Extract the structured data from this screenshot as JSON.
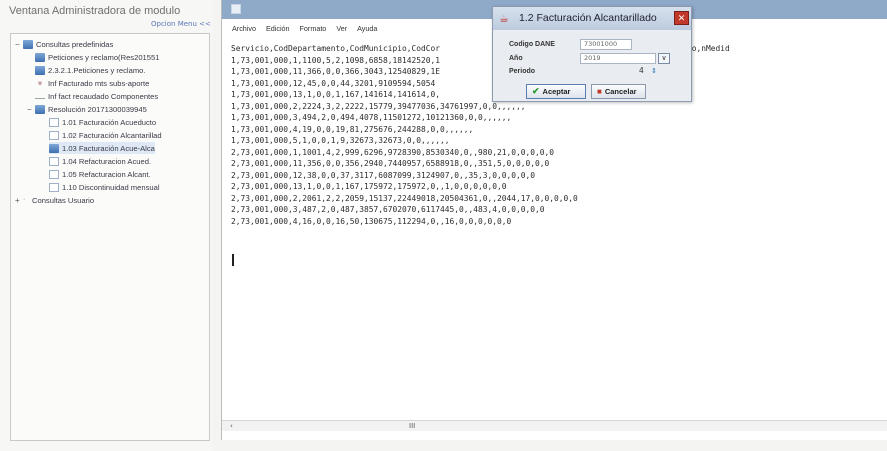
{
  "left_panel": {
    "title": "Ventana Administradora de modulo",
    "options_menu": "Opcion Menu <<",
    "tree": [
      {
        "label": "Consultas predefinidas",
        "expand": "−",
        "icon": "db-icon"
      },
      {
        "label": "Peticiones y reclamo(Res201551",
        "expand": "",
        "icon": "db-icon"
      },
      {
        "label": "2.3.2.1.Peticiones y reclamo.",
        "expand": "",
        "icon": "db-icon"
      },
      {
        "label": "Inf Facturado mts subs-aporte",
        "expand": "",
        "icon": "heart-icon"
      },
      {
        "label": "Inf fact recaudado Componentes",
        "expand": "",
        "icon": "dash-icon"
      },
      {
        "label": "Resolución 20171300039945",
        "expand": "−",
        "icon": "db-icon"
      },
      {
        "label": "1.01 Facturación Acueducto",
        "expand": "",
        "icon": "doc-icon"
      },
      {
        "label": "1.02 Facturación Alcantarillad",
        "expand": "",
        "icon": "doc-icon"
      },
      {
        "label": "1.03 Facturación Acue-Alca",
        "expand": "",
        "icon": "db-icon"
      },
      {
        "label": "1.04 Refacturacion Acued.",
        "expand": "",
        "icon": "doc-icon"
      },
      {
        "label": "1.05 Refacturacion Alcant.",
        "expand": "",
        "icon": "doc-icon"
      },
      {
        "label": "1.10 Discontinuidad mensual",
        "expand": "",
        "icon": "doc-icon"
      },
      {
        "label": "Consultas Usuario",
        "expand": "+",
        "icon": "dot-icon"
      }
    ]
  },
  "editor": {
    "menu": [
      "Archivo",
      "Edición",
      "Formato",
      "Ver",
      "Ayuda"
    ],
    "lines": [
      "Servicio,CodDepartamento,CodMunicipio,CodCor                            ,nSuspendido,nDesconectado,nMedid",
      "1,73,001,000,1,1100,5,2,1098,6858,18142520,1",
      "1,73,001,000,11,366,0,0,366,3043,12540829,1E",
      "1,73,001,000,12,45,0,0,44,3201,9109594,5054",
      "1,73,001,000,13,1,0,0,1,167,141614,141614,0,",
      "1,73,001,000,2,2224,3,2,2222,15779,39477036,34761997,0,0,,,,,,",
      "1,73,001,000,3,494,2,0,494,4078,11501272,10121360,0,0,,,,,,",
      "1,73,001,000,4,19,0,0,19,81,275676,244288,0,0,,,,,,",
      "1,73,001,000,5,1,0,0,1,9,32673,32673,0,0,,,,,,",
      "2,73,001,000,1,1001,4,2,999,6296,9728390,8530340,0,,980,21,0,0,0,0,0",
      "2,73,001,000,11,356,0,0,356,2940,7440957,6588918,0,,351,5,0,0,0,0,0",
      "2,73,001,000,12,38,0,0,37,3117,6087099,3124907,0,,35,3,0,0,0,0,0",
      "2,73,001,000,13,1,0,0,1,167,175972,175972,0,,1,0,0,0,0,0,0",
      "2,73,001,000,2,2061,2,2,2059,15137,22449018,20504361,0,,2044,17,0,0,0,0,0",
      "2,73,001,000,3,487,2,0,487,3857,6702070,6117445,0,,483,4,0,0,0,0,0",
      "2,73,001,000,4,16,0,0,16,50,130675,112294,0,,16,0,0,0,0,0,0"
    ],
    "scroll_arrow": "‹",
    "scroll_thumb": "III"
  },
  "dialog": {
    "title": "1.2 Facturación Alcantarillado",
    "close": "✕",
    "fields": {
      "dane_label": "Codigo DANE",
      "dane_value": "73001000",
      "year_label": "Año",
      "year_value": "2019",
      "year_button": "∨",
      "period_label": "Periodo",
      "period_value": "4"
    },
    "accept_label": "Aceptar",
    "cancel_label": "Cancelar"
  }
}
